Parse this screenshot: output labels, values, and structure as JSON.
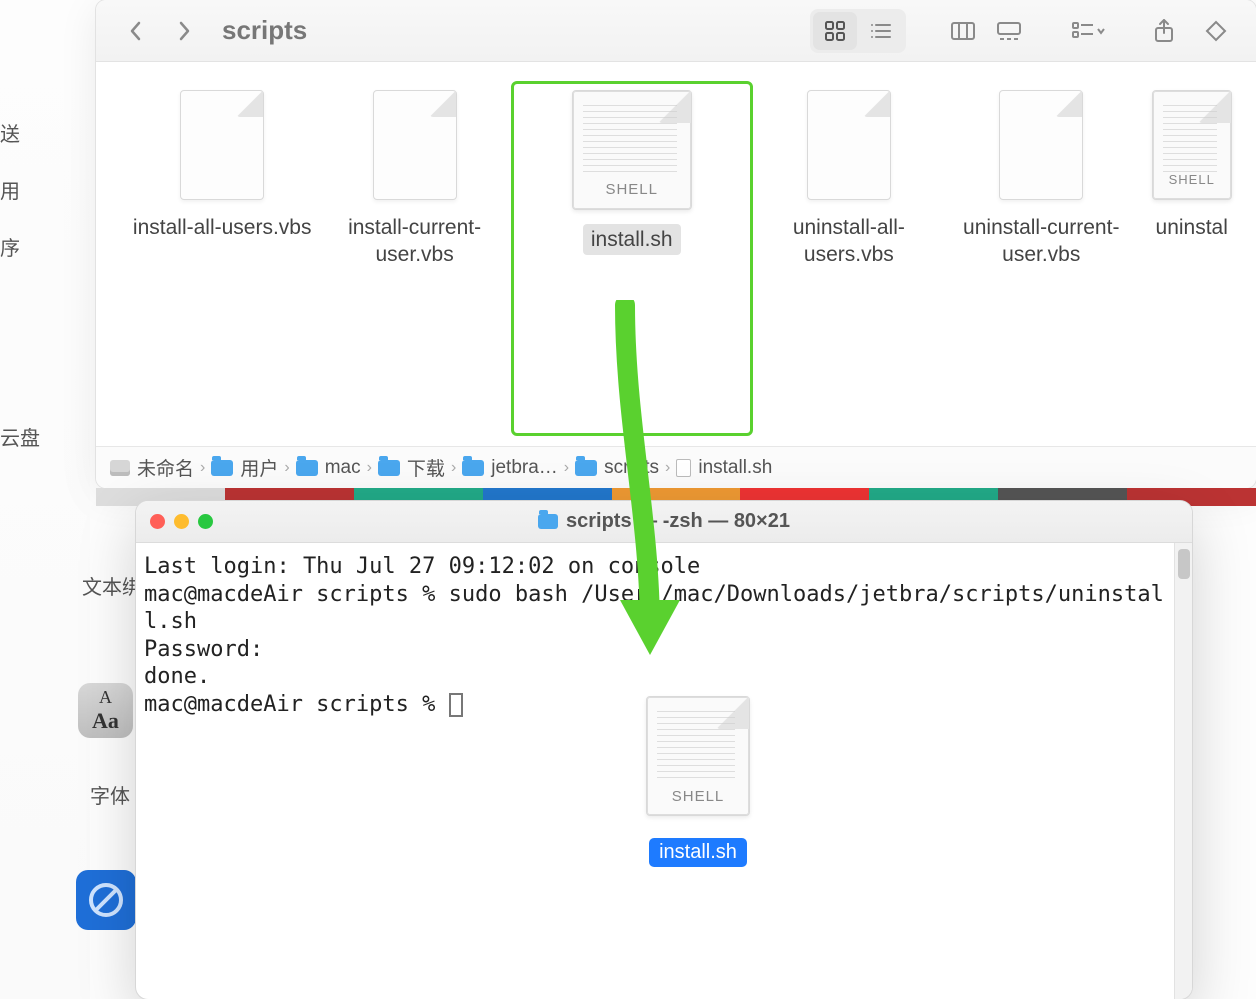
{
  "left_strip": {
    "items": [
      "送",
      "用",
      "序",
      "云盘"
    ],
    "text_label": "文本绑",
    "font_label": "字体"
  },
  "finder": {
    "title": "scripts",
    "files": [
      {
        "name": "install-all-users.vbs",
        "type": "vbs"
      },
      {
        "name": "install-current-user.vbs",
        "type": "vbs"
      },
      {
        "name": "install.sh",
        "type": "shell",
        "selected": true
      },
      {
        "name": "uninstall-all-users.vbs",
        "type": "vbs"
      },
      {
        "name": "uninstall-current-user.vbs",
        "type": "vbs"
      },
      {
        "name": "uninstal",
        "type": "shell_partial"
      }
    ],
    "shell_badge": "SHELL",
    "path": [
      {
        "icon": "disk",
        "label": "未命名"
      },
      {
        "icon": "folder",
        "label": "用户"
      },
      {
        "icon": "folder",
        "label": "mac"
      },
      {
        "icon": "folder",
        "label": "下载"
      },
      {
        "icon": "folder",
        "label": "jetbra…"
      },
      {
        "icon": "folder",
        "label": "scripts"
      },
      {
        "icon": "doc",
        "label": "install.sh"
      }
    ]
  },
  "terminal": {
    "title": "scripts — -zsh — 80×21",
    "lines": {
      "l1": "Last login: Thu Jul 27 09:12:02 on console",
      "l2a": "mac@macdeAir scripts % ",
      "l2b": "sudo bash /Users/mac/Downloads/jetbra/scripts/uninstall.sh",
      "l3": "Password:",
      "l4": "done.",
      "l5": "mac@macdeAir scripts % "
    },
    "dragged_file": "install.sh"
  },
  "colors": {
    "highlight_green": "#5ad12f",
    "selection_blue": "#1e7bff"
  }
}
